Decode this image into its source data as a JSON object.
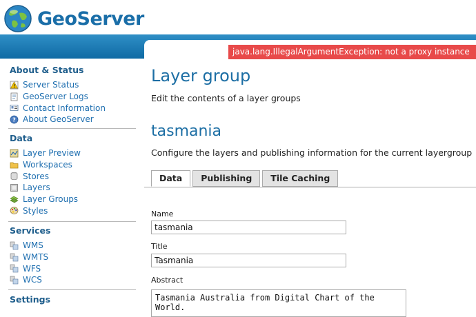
{
  "app": {
    "name": "GeoServer"
  },
  "sidebar": {
    "sections": [
      {
        "title": "About & Status",
        "items": [
          {
            "label": "Server Status",
            "icon": "warning-icon"
          },
          {
            "label": "GeoServer Logs",
            "icon": "document-icon"
          },
          {
            "label": "Contact Information",
            "icon": "contact-card-icon"
          },
          {
            "label": "About GeoServer",
            "icon": "help-icon"
          }
        ]
      },
      {
        "title": "Data",
        "items": [
          {
            "label": "Layer Preview",
            "icon": "map-preview-icon"
          },
          {
            "label": "Workspaces",
            "icon": "folder-icon"
          },
          {
            "label": "Stores",
            "icon": "database-icon"
          },
          {
            "label": "Layers",
            "icon": "layers-icon"
          },
          {
            "label": "Layer Groups",
            "icon": "layer-groups-icon"
          },
          {
            "label": "Styles",
            "icon": "palette-icon"
          }
        ]
      },
      {
        "title": "Services",
        "items": [
          {
            "label": "WMS",
            "icon": "service-icon"
          },
          {
            "label": "WMTS",
            "icon": "service-icon"
          },
          {
            "label": "WFS",
            "icon": "service-icon"
          },
          {
            "label": "WCS",
            "icon": "service-icon"
          }
        ]
      },
      {
        "title": "Settings",
        "items": []
      }
    ]
  },
  "main": {
    "error": "java.lang.IllegalArgumentException: not a proxy instance",
    "title": "Layer group",
    "subtitle": "Edit the contents of a layer groups",
    "group_name": "tasmania",
    "group_description": "Configure the layers and publishing information for the current layergroup",
    "tabs": [
      {
        "label": "Data",
        "active": true
      },
      {
        "label": "Publishing",
        "active": false
      },
      {
        "label": "Tile Caching",
        "active": false
      }
    ],
    "form": {
      "name_label": "Name",
      "name_value": "tasmania",
      "title_label": "Title",
      "title_value": "Tasmania",
      "abstract_label": "Abstract",
      "abstract_value": "Tasmania Australia from Digital Chart of the World."
    }
  },
  "colors": {
    "brand": "#1a6ea8",
    "banner": "#1b7ab5",
    "error_bg": "#e84a4a",
    "heading": "#1c6ea4",
    "section_title": "#1f5e8c",
    "link": "#1f6fb0"
  }
}
